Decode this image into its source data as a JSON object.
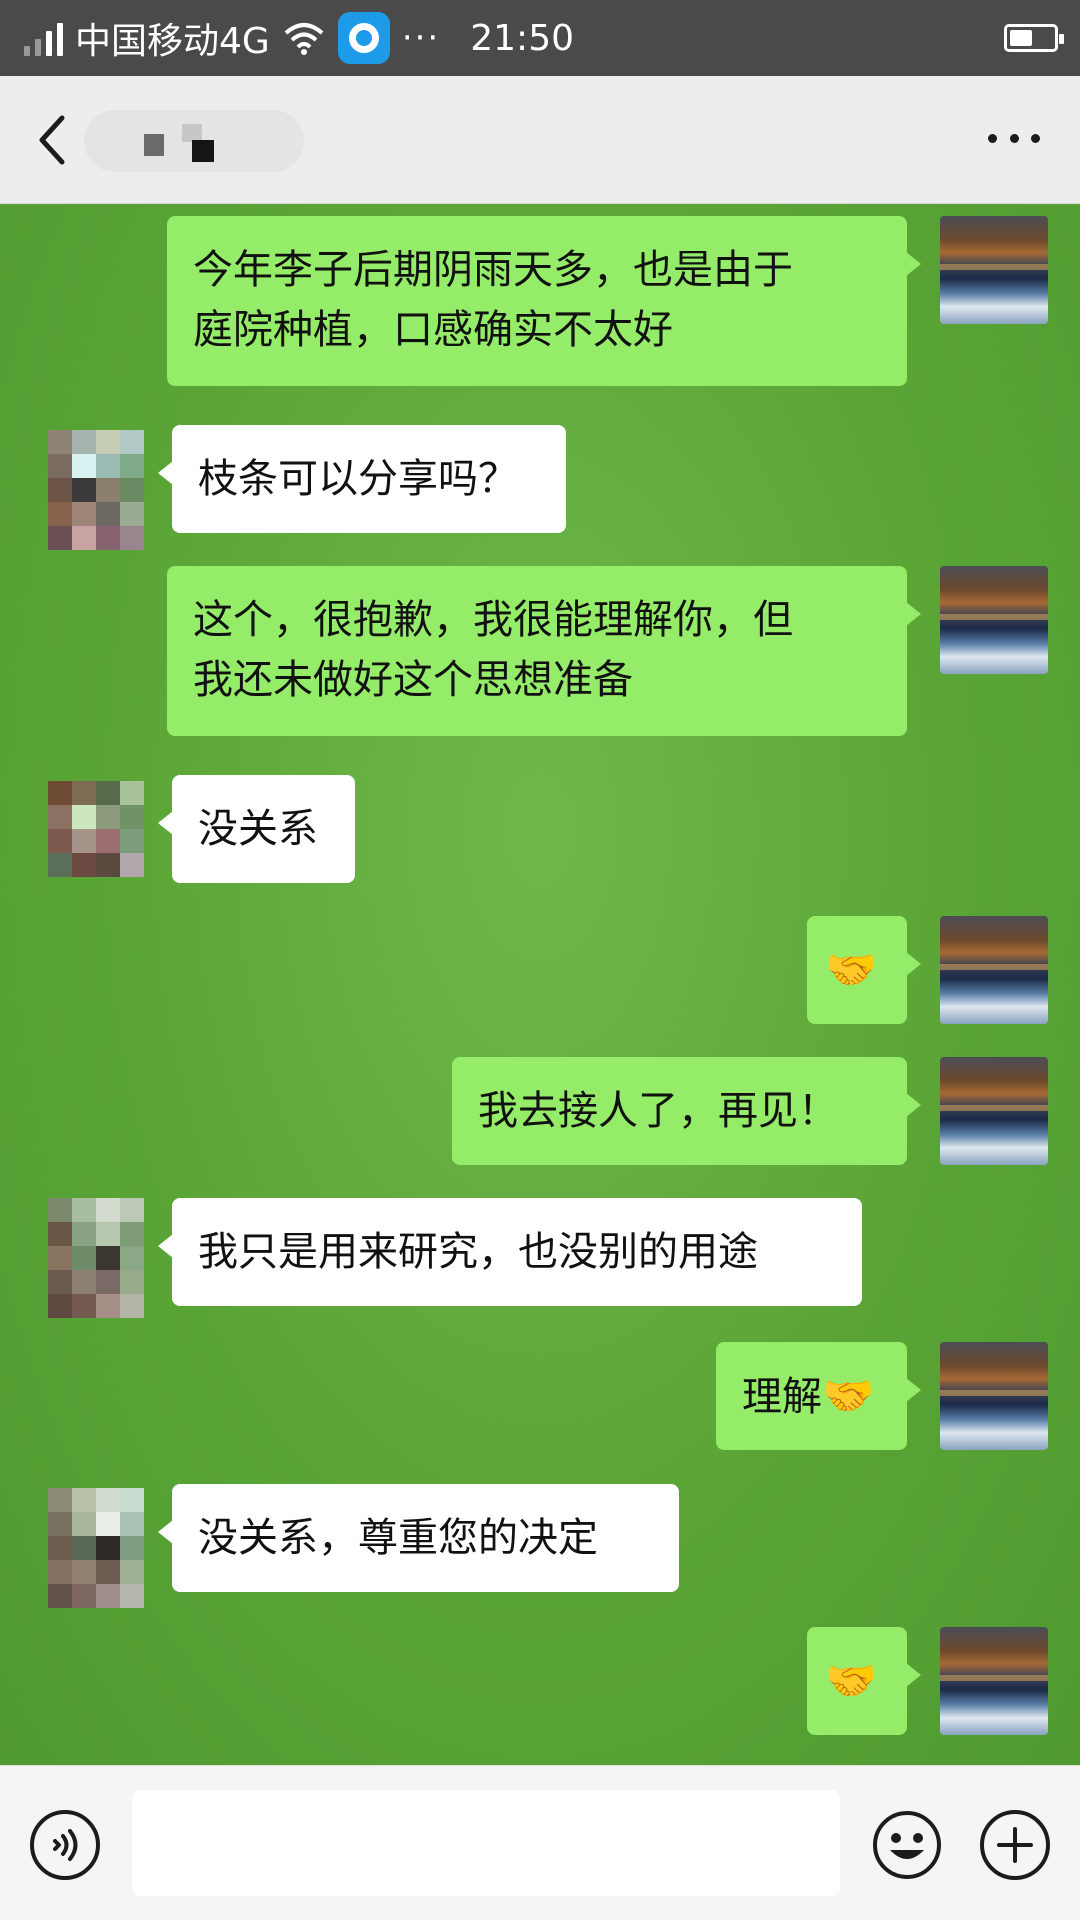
{
  "status_bar": {
    "carrier": "中国移动4G",
    "more": "···",
    "time": "21:50"
  },
  "header": {
    "back_icon": "chevron-left-icon",
    "contact_name": "",
    "more_icon": "more-dots-icon"
  },
  "messages": [
    {
      "direction": "out",
      "text": "今年李子后期阴雨天多，也是由于\n庭院种植，口感确实不太好"
    },
    {
      "direction": "in",
      "text": "枝条可以分享吗？"
    },
    {
      "direction": "out",
      "text": "这个，很抱歉，我很能理解你，但\n我还未做好这个思想准备"
    },
    {
      "direction": "in",
      "text": "没关系"
    },
    {
      "direction": "out",
      "text": "",
      "emoji": "🤝"
    },
    {
      "direction": "out",
      "text": "我去接人了，再见！"
    },
    {
      "direction": "in",
      "text": "我只是用来研究，也没别的用途"
    },
    {
      "direction": "out",
      "text": "理解",
      "emoji": "🤝"
    },
    {
      "direction": "in",
      "text": "没关系，尊重您的决定"
    },
    {
      "direction": "out",
      "text": "",
      "emoji": "🤝"
    }
  ],
  "input_bar": {
    "voice_icon": "voice-icon",
    "input_value": "",
    "emoji_icon": "emoji-icon",
    "plus_icon": "plus-icon"
  },
  "colors": {
    "chat_background": "#5aa438",
    "outgoing_bubble": "#95ec69",
    "incoming_bubble": "#ffffff",
    "header_background": "#ededed",
    "status_bar": "#4a4a4a"
  }
}
